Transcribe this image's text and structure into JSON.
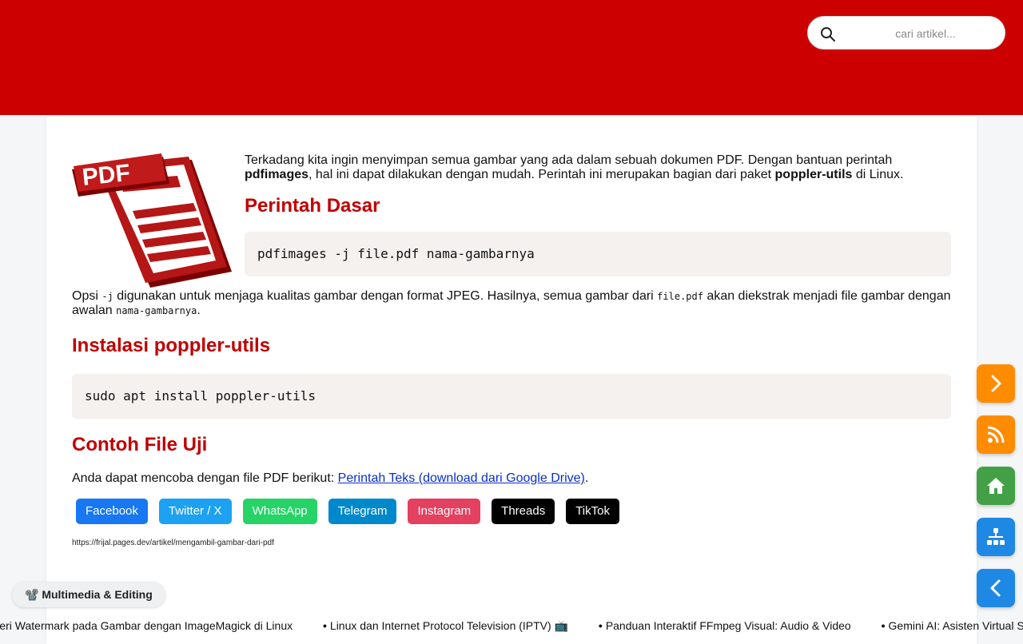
{
  "search": {
    "placeholder": "cari artikel..."
  },
  "article": {
    "intro_part1": "Terkadang kita ingin menyimpan semua gambar yang ada dalam sebuah dokumen PDF. Dengan bantuan perintah ",
    "intro_bold1": "pdfimages",
    "intro_part2": ", hal ini dapat dilakukan dengan mudah. Perintah ini merupakan bagian dari paket ",
    "intro_bold2": "poppler-utils",
    "intro_part3": " di Linux.",
    "heading_basic": "Perintah Dasar",
    "code_basic": "pdfimages -j file.pdf nama-gambarnya",
    "opsi_part1": "Opsi ",
    "opsi_code1": "-j",
    "opsi_part2": " digunakan untuk menjaga kualitas gambar dengan format JPEG. Hasilnya, semua gambar dari ",
    "opsi_code2": "file.pdf",
    "opsi_part3": " akan diekstrak menjadi file gambar dengan awalan ",
    "opsi_code3": "nama-gambarnya",
    "opsi_part4": ".",
    "heading_install": "Instalasi poppler-utils",
    "code_install": "sudo apt install poppler-utils",
    "heading_sample": "Contoh File Uji",
    "sample_text": "Anda dapat mencoba dengan file PDF berikut: ",
    "sample_link": "Perintah Teks (download dari Google Drive)",
    "sample_end": ".",
    "page_url": "https://frijal.pages.dev/artikel/mengambil-gambar-dari-pdf",
    "logo_text": "PDF"
  },
  "share_buttons": [
    {
      "label": "Facebook",
      "color": "#1877f2"
    },
    {
      "label": "Twitter / X",
      "color": "#1da1f2"
    },
    {
      "label": "WhatsApp",
      "color": "#25d366"
    },
    {
      "label": "Telegram",
      "color": "#0088cc"
    },
    {
      "label": "Instagram",
      "color": "#e4405f"
    },
    {
      "label": "Threads",
      "color": "#000000"
    },
    {
      "label": "TikTok",
      "color": "#000000"
    }
  ],
  "fab_buttons": [
    {
      "name": "next",
      "icon": "chevron-right-icon",
      "color": "#ff8c00"
    },
    {
      "name": "rss",
      "icon": "rss-icon",
      "color": "#ff8c00"
    },
    {
      "name": "home",
      "icon": "home-icon",
      "color": "#43a047"
    },
    {
      "name": "sitemap",
      "icon": "sitemap-icon",
      "color": "#1e88e5"
    },
    {
      "name": "back",
      "icon": "chevron-left-icon",
      "color": "#1e88e5"
    }
  ],
  "category": {
    "emoji": "📽️",
    "label": "Multimedia & Editing"
  },
  "ticker": [
    "Beri Watermark pada Gambar dengan ImageMagick di Linux",
    "Linux dan Internet Protocol Television (IPTV) 📺",
    "Panduan Interaktif FFmpeg Visual: Audio & Video",
    "Gemini AI: Asisten Virtual Serbaguna"
  ],
  "colors": {
    "brand_red": "#cc0000",
    "heading_red": "#c00000",
    "link": "#0a2fcc"
  }
}
